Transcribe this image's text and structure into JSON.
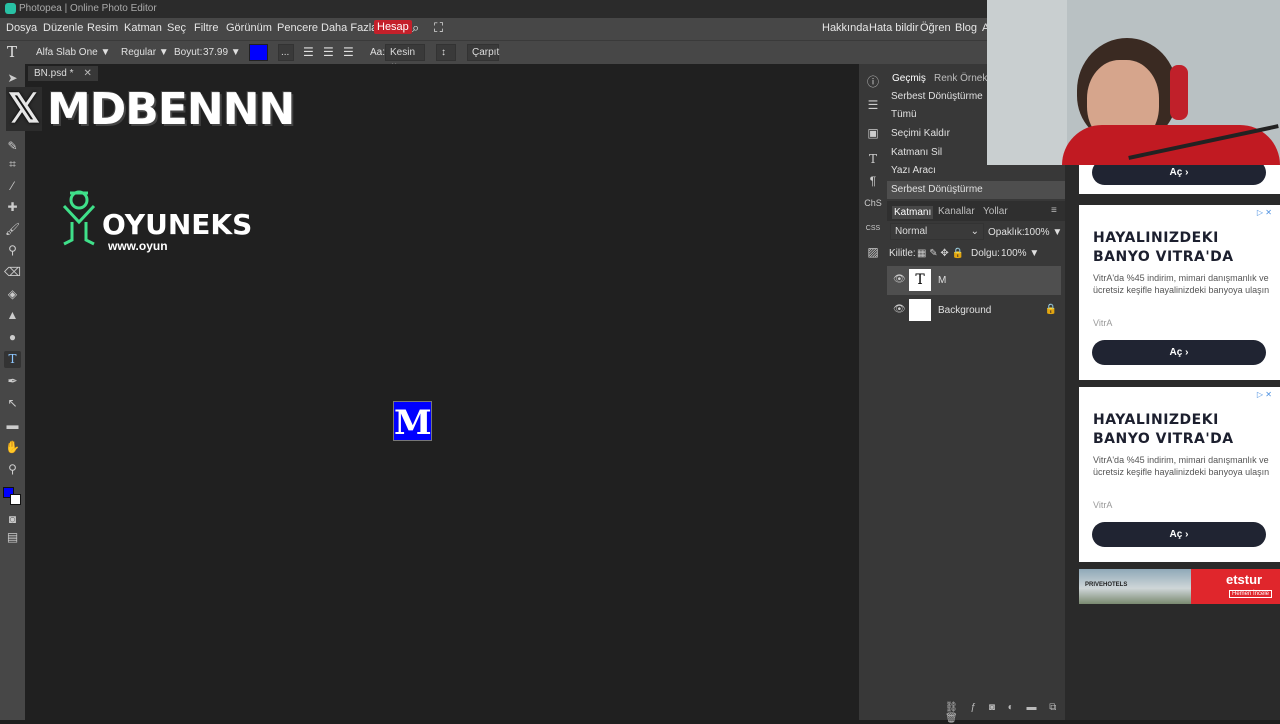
{
  "window": {
    "title": "Photopea | Online Photo Editor"
  },
  "menu": {
    "items": [
      "Dosya",
      "Düzenle",
      "Resim",
      "Katman",
      "Seç",
      "Filtre",
      "Görünüm",
      "Pencere",
      "Daha Fazla",
      "Hesap"
    ],
    "right_items": [
      "Hakkında",
      "Hata bildir",
      "Öğren",
      "Blog",
      "A"
    ]
  },
  "options": {
    "font_family": "Alfa Slab One",
    "font_style": "Regular",
    "size_label": "Boyut:",
    "size_value": "37.99",
    "text_color": "#0000ff",
    "more": "...",
    "aa_label": "Aa:",
    "aa_value": "Kesin",
    "orientation": "↕",
    "warp_label": "Çarpıt"
  },
  "document": {
    "tab_title": "BN.psd *",
    "canvas_letter": "M"
  },
  "overlay": {
    "x_handle": "MDBENNN",
    "brand_name": "OYUNEKS",
    "brand_url": "www.oyun"
  },
  "panels": {
    "top_tabs": [
      "Geçmiş",
      "Renk Örnekle"
    ],
    "history": [
      "Serbest Dönüştürme",
      "Tümü",
      "Seçimi Kaldır",
      "Katmanı Sil",
      "Yazı Aracı",
      "Serbest Dönüştürme"
    ],
    "layer_tabs": [
      "Katmanı",
      "Kanallar",
      "Yollar"
    ],
    "blend_mode": "Normal",
    "opacity_label": "Opaklık:",
    "opacity_value": "100%",
    "lock_label": "Kilitle:",
    "fill_label": "Dolgu:",
    "fill_value": "100%",
    "layers": [
      {
        "name": "M",
        "type": "text",
        "thumb": "T",
        "selected": true
      },
      {
        "name": "Background",
        "type": "image",
        "thumb": "",
        "locked": true,
        "selected": false
      }
    ]
  },
  "icon_col": {
    "chs_label": "ChS",
    "css_label": "CSS"
  },
  "ads": {
    "top_button": "Aç",
    "cards": [
      {
        "title": "HAYALINIZDEKI BANYO VITRA'DA",
        "desc": "VitrA'da %45 indirim, mimari danışmanlık ve ücretsiz keşifle hayalinizdeki banyoya ulaşın",
        "brand": "VitrA",
        "button": "Aç"
      },
      {
        "title": "HAYALINIZDEKI BANYO VITRA'DA",
        "desc": "VitrA'da %45 indirim, mimari danışmanlık ve ücretsiz keşifle hayalinizdeki banyoya ulaşın",
        "brand": "VitrA",
        "button": "Aç"
      }
    ],
    "banner_left": "PRIVEHOTELS",
    "banner_right_brand": "etstur",
    "banner_right_cta": "Hemen İncele"
  },
  "colors": {
    "accent_red": "#c4202a",
    "text_blue": "#0000ff",
    "oyuneks_green": "#3fe08a"
  }
}
